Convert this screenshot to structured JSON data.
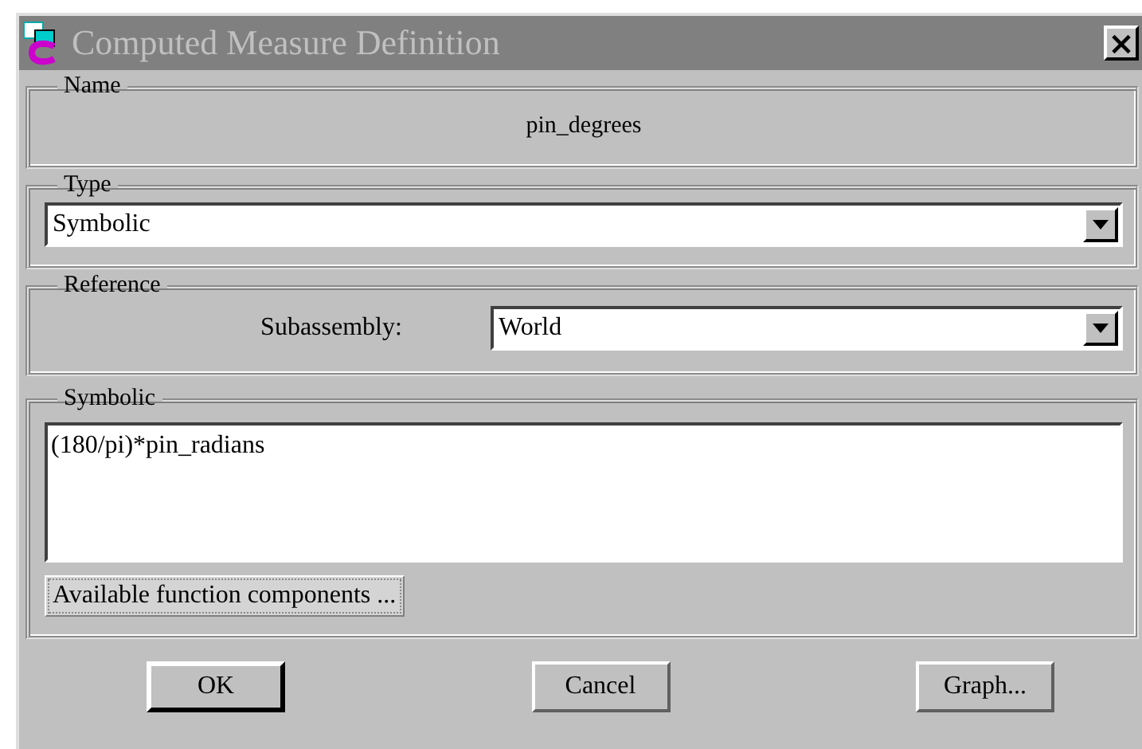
{
  "window": {
    "title": "Computed Measure Definition",
    "close": "×",
    "active": false
  },
  "name_group": {
    "legend": "Name",
    "value": "pin_degrees"
  },
  "type_group": {
    "legend": "Type",
    "value": "Symbolic"
  },
  "reference_group": {
    "legend": "Reference",
    "label": "Subassembly:",
    "value": "World"
  },
  "symbolic_group": {
    "legend": "Symbolic",
    "expression": "(180/pi)*pin_radians",
    "button": "Available function components ..."
  },
  "buttons": [
    {
      "label": "OK",
      "default": true
    },
    {
      "label": "Cancel",
      "default": false
    },
    {
      "label": "Graph...",
      "default": false
    }
  ]
}
